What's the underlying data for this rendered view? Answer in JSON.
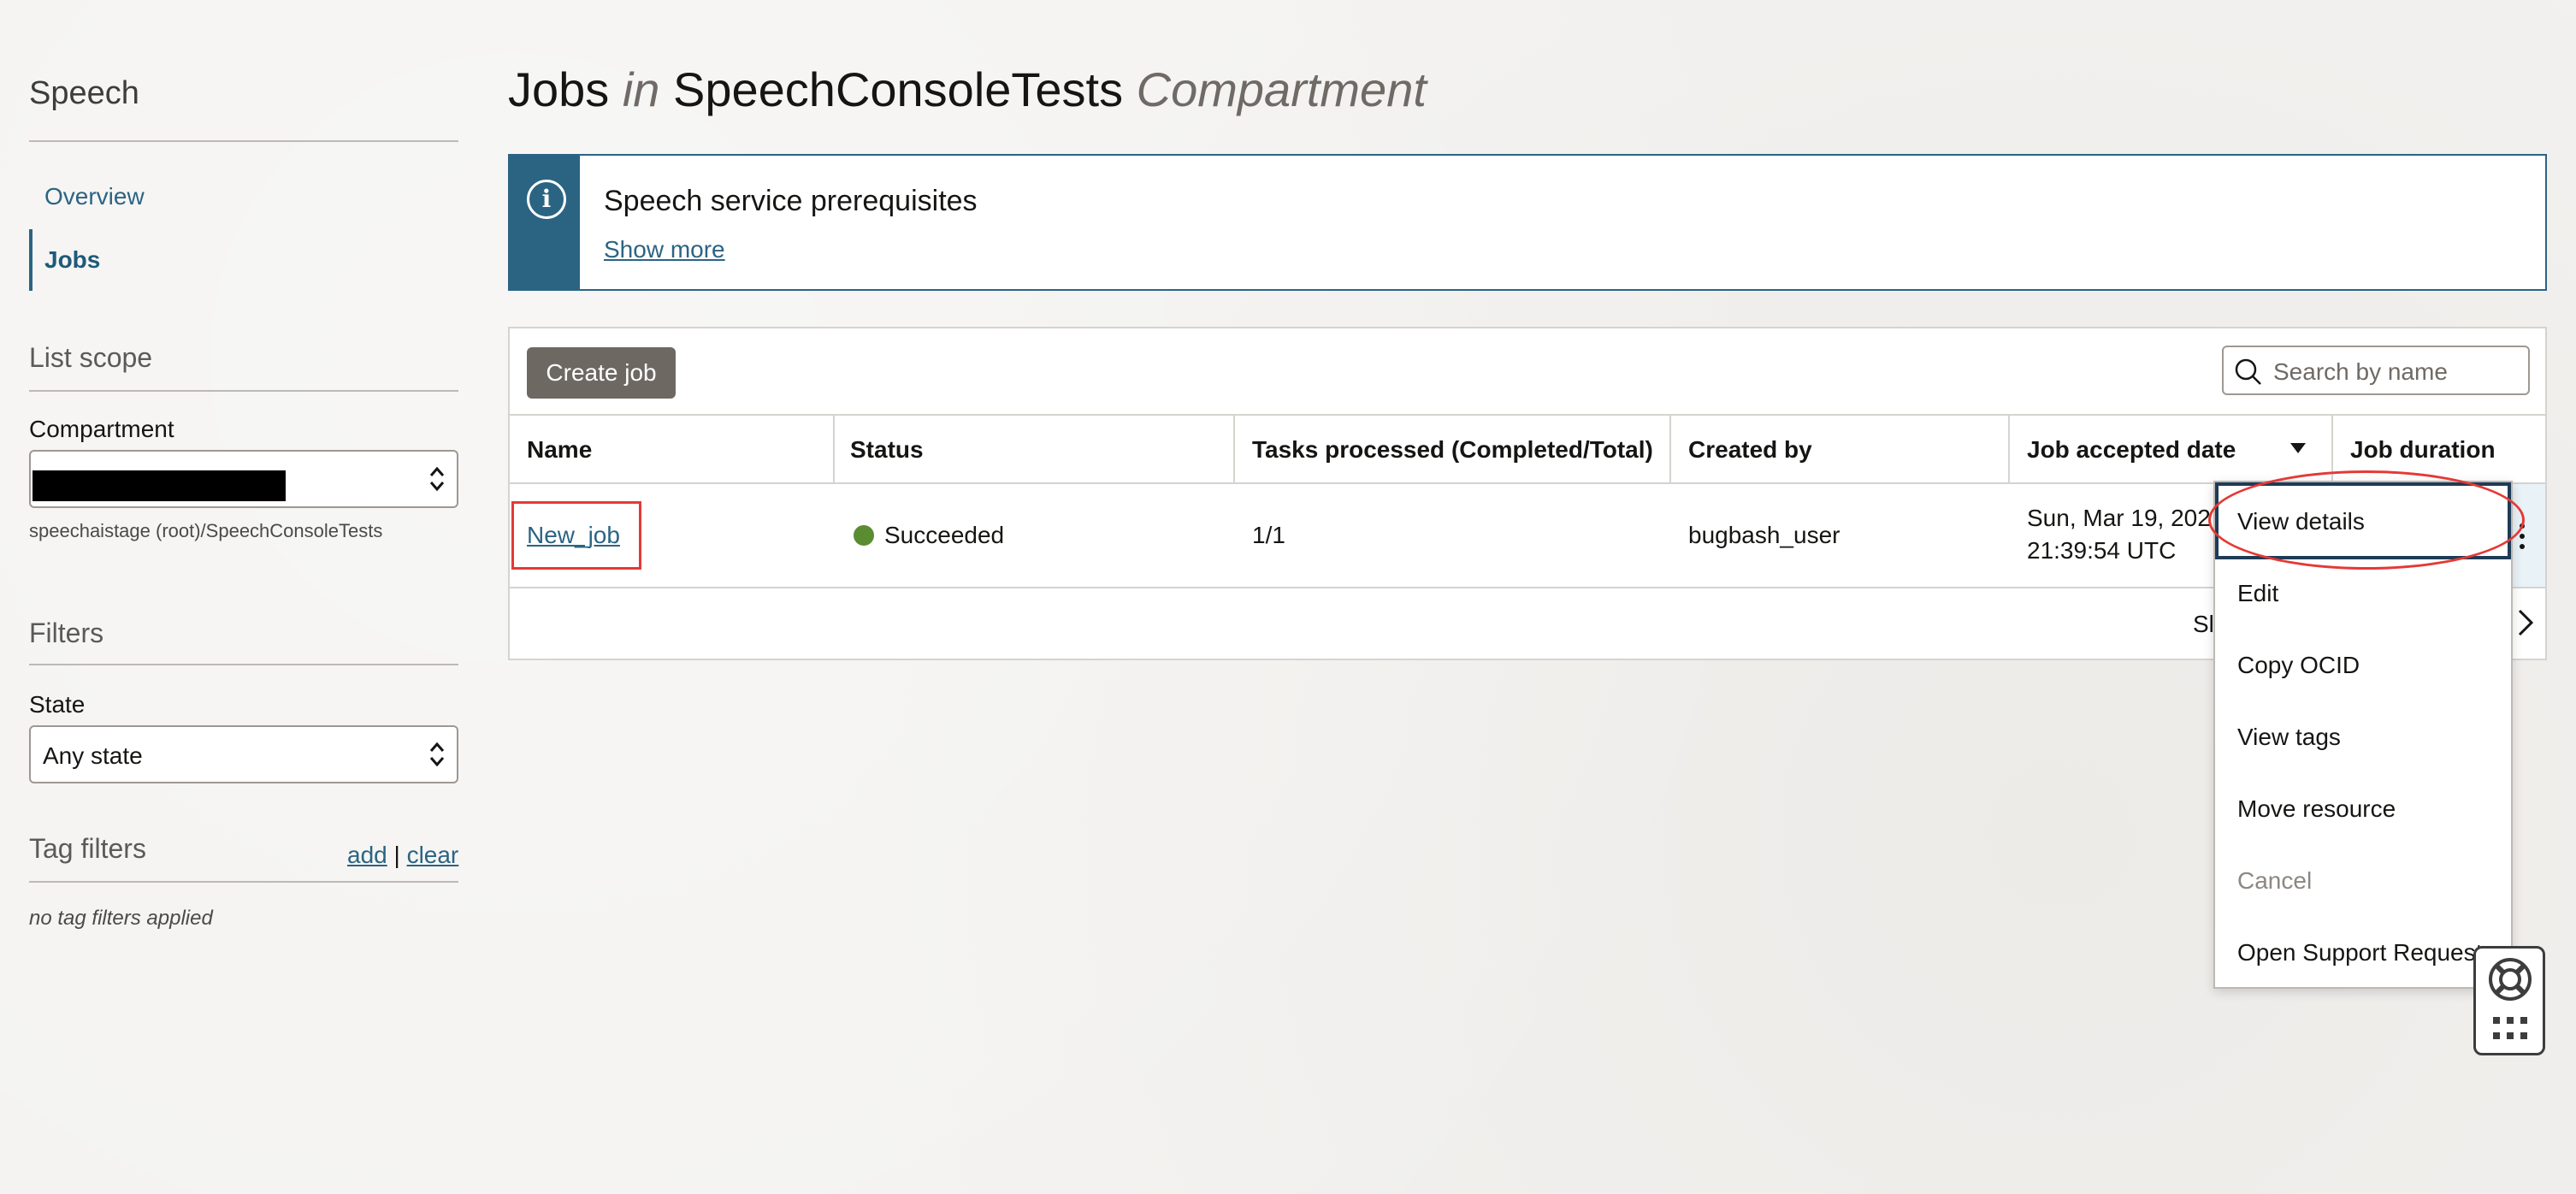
{
  "sidebar": {
    "service_title": "Speech",
    "nav": [
      {
        "label": "Overview",
        "active": false
      },
      {
        "label": "Jobs",
        "active": true
      }
    ],
    "list_scope": {
      "heading": "List scope",
      "compartment_label": "Compartment",
      "compartment_value": "",
      "compartment_path": "speechaistage (root)/SpeechConsoleTests"
    },
    "filters": {
      "heading": "Filters",
      "state_label": "State",
      "state_value": "Any state"
    },
    "tag_filters": {
      "heading": "Tag filters",
      "add": "add",
      "sep": "|",
      "clear": "clear",
      "note": "no tag filters applied"
    }
  },
  "header": {
    "title_main": "Jobs",
    "title_in": "in",
    "title_compartment": "SpeechConsoleTests",
    "title_suffix": "Compartment"
  },
  "banner": {
    "icon": "info-icon",
    "title": "Speech service prerequisites",
    "link": "Show more",
    "accent": "#2b6483"
  },
  "toolbar": {
    "create_label": "Create job",
    "search_placeholder": "Search by name"
  },
  "table": {
    "columns": [
      "Name",
      "Status",
      "Tasks processed (Completed/Total)",
      "Created by",
      "Job accepted date",
      "Job duration"
    ],
    "rows": [
      {
        "name": "New_job",
        "status": "Succeeded",
        "status_color": "#5a8c32",
        "tasks": "1/1",
        "created_by": "bugbash_user",
        "accepted_date_line1": "Sun, Mar 19, 202",
        "accepted_date_line2": "21:39:54 UTC"
      }
    ],
    "pager_text": "Sl"
  },
  "row_menu": {
    "items": [
      {
        "label": "View details",
        "enabled": true,
        "focused": true
      },
      {
        "label": "Edit",
        "enabled": true
      },
      {
        "label": "Copy OCID",
        "enabled": true
      },
      {
        "label": "View tags",
        "enabled": true
      },
      {
        "label": "Move resource",
        "enabled": true
      },
      {
        "label": "Cancel",
        "enabled": false
      },
      {
        "label": "Open Support Request",
        "enabled": true
      }
    ]
  },
  "help_widget": {
    "icon": "lifebuoy-icon",
    "apps_icon": "grid-icon"
  }
}
